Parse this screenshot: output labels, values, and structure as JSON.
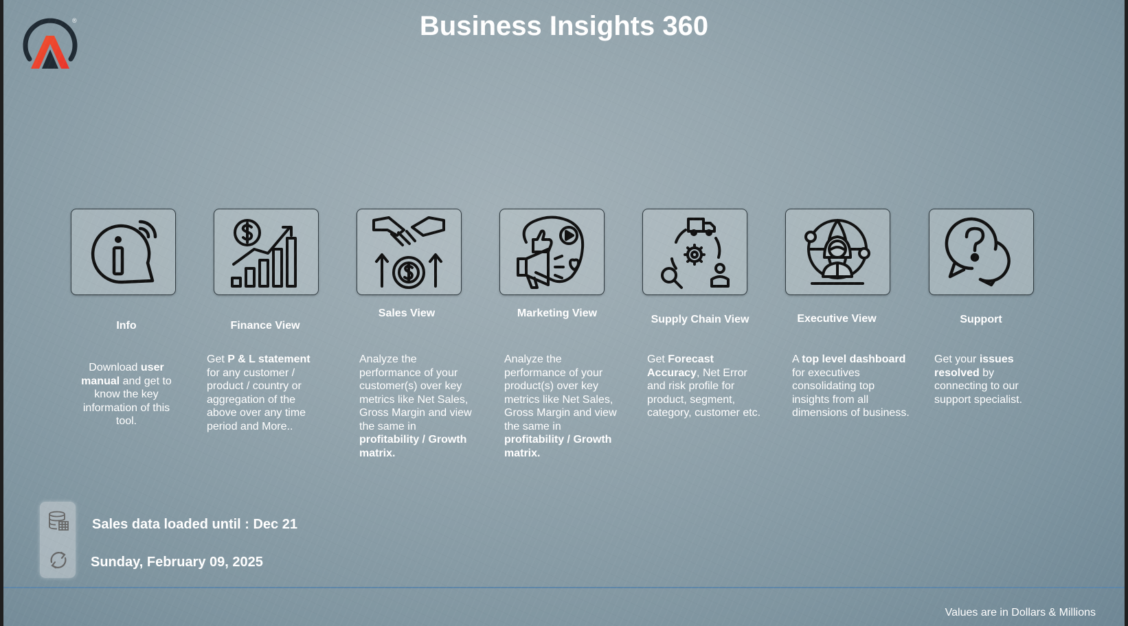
{
  "header": {
    "title": "Business Insights 360",
    "logo_icon": "atliq-logo-icon",
    "logo_mark": "®"
  },
  "tiles": [
    {
      "label": "Info",
      "icon": "info-icon",
      "description": [
        {
          "t": "Download "
        },
        {
          "t": "user manual",
          "b": true
        },
        {
          "t": " and get to know the key information of this tool."
        }
      ]
    },
    {
      "label": "Finance View",
      "icon": "finance-growth-icon",
      "description": [
        {
          "t": "Get  "
        },
        {
          "t": "P & L statement",
          "b": true
        },
        {
          "t": " for any customer / product / country or aggregation of the above over any time period and More.."
        }
      ]
    },
    {
      "label": "Sales View",
      "icon": "handshake-dollar-icon",
      "description": [
        {
          "t": "Analyze the performance of your customer(s) over key metrics like Net Sales, Gross Margin and view the same in "
        },
        {
          "t": "profitability / Growth matrix.",
          "b": true
        }
      ]
    },
    {
      "label": "Marketing View",
      "icon": "megaphone-icon",
      "description": [
        {
          "t": "Analyze the performance of your product(s) over key metrics like Net Sales, Gross Margin and view the same in "
        },
        {
          "t": "profitability / Growth matrix.",
          "b": true
        }
      ]
    },
    {
      "label": "Supply Chain View",
      "icon": "supply-chain-icon",
      "description": [
        {
          "t": "Get "
        },
        {
          "t": "Forecast Accuracy",
          "b": true
        },
        {
          "t": ", Net Error and risk profile for product, segment, category, customer etc."
        }
      ]
    },
    {
      "label": "Executive View",
      "icon": "executive-globe-icon",
      "description": [
        {
          "t": "A "
        },
        {
          "t": "top level dashboard",
          "b": true
        },
        {
          "t": " for executives consolidating top insights from all dimensions of business."
        }
      ]
    },
    {
      "label": "Support",
      "icon": "support-chat-icon",
      "description": [
        {
          "t": "Get your "
        },
        {
          "t": "issues resolved",
          "b": true
        },
        {
          "t": " by connecting to our support specialist."
        }
      ]
    }
  ],
  "status": {
    "data_loaded": "Sales data loaded until : Dec 21",
    "date": "Sunday, February 09, 2025",
    "database_icon": "database-icon",
    "refresh_icon": "refresh-icon"
  },
  "footer": {
    "note": "Values are in Dollars & Millions"
  }
}
